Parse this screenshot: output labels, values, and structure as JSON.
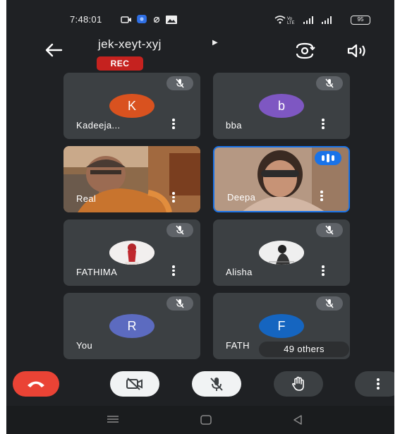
{
  "status_bar": {
    "time": "7:48:01",
    "battery": "95"
  },
  "header": {
    "meeting_code": "jek-xeyt-xyj",
    "rec_label": "REC"
  },
  "participants": [
    {
      "name": "Kadeeja...",
      "initial": "K",
      "avatar_color": "#d9521f",
      "muted": true
    },
    {
      "name": "bba",
      "initial": "b",
      "avatar_color": "#7e57c2",
      "muted": true
    },
    {
      "name": "Real",
      "video": true,
      "muted": false
    },
    {
      "name": "Deepa",
      "video": true,
      "speaking": true
    },
    {
      "name": "FATHIMA",
      "photo": true,
      "muted": true
    },
    {
      "name": "Alisha",
      "photo": true,
      "muted": true
    },
    {
      "name": "You",
      "initial": "R",
      "avatar_color": "#5c6bc0",
      "muted": true
    },
    {
      "name": "FATH",
      "initial": "F",
      "avatar_color": "#1565c0",
      "muted": true
    }
  ],
  "others_label": "49 others",
  "controls": {
    "end_call": "end-call",
    "camera": "camera-off",
    "mic": "mic-off",
    "raise_hand": "raise-hand",
    "more": "more-options"
  },
  "colors": {
    "end_call": "#ea4335",
    "rec": "#c5221f",
    "speaking": "#1a73e8",
    "background": "#1f2124",
    "tile": "#3c4043"
  }
}
